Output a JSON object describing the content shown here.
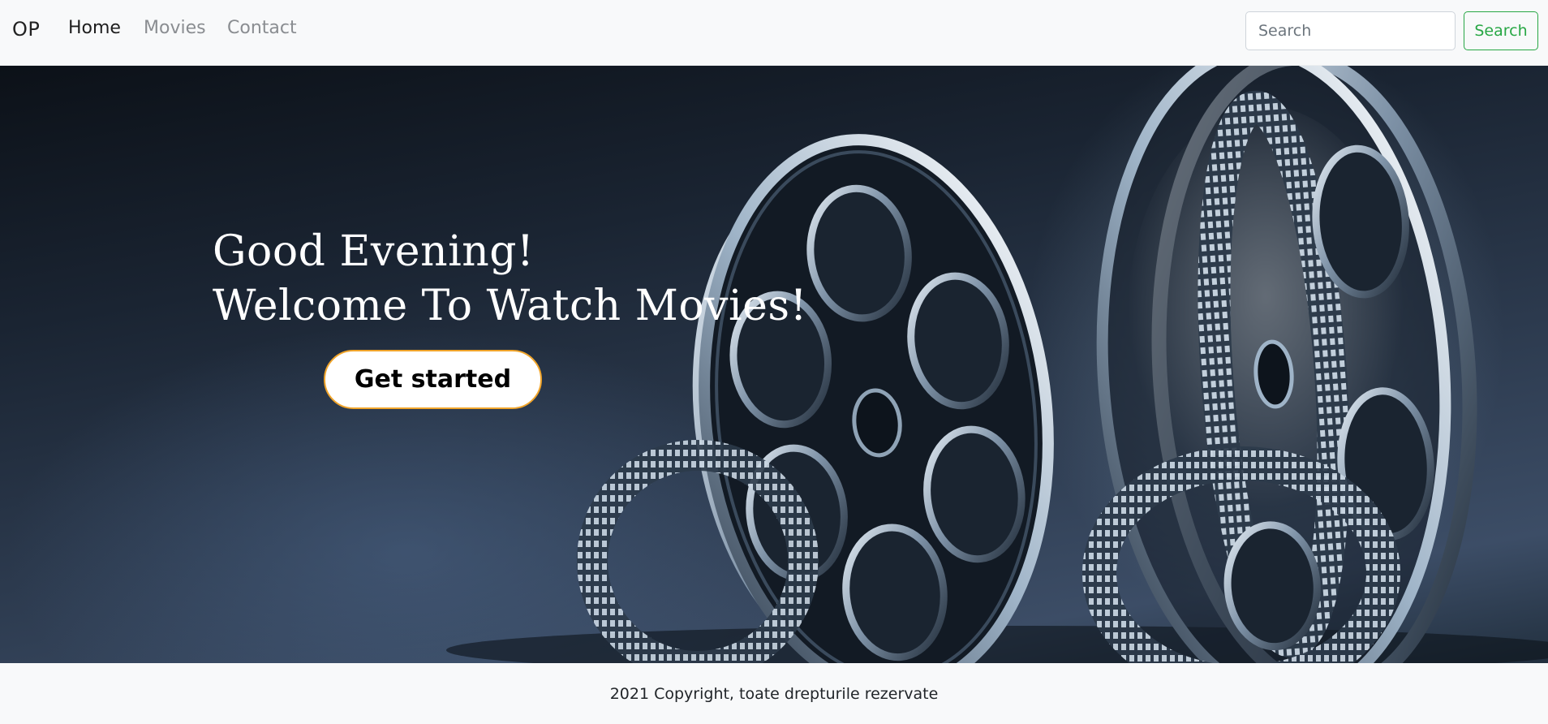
{
  "navbar": {
    "brand": "OP",
    "links": [
      {
        "label": "Home",
        "active": true
      },
      {
        "label": "Movies",
        "active": false
      },
      {
        "label": "Contact",
        "active": false
      }
    ],
    "search": {
      "placeholder": "Search",
      "value": "",
      "button_label": "Search"
    }
  },
  "hero": {
    "greeting": "Good Evening!",
    "welcome": "Welcome To Watch Movies!",
    "cta_label": "Get started",
    "background_image": "film-reels"
  },
  "footer": {
    "text": "2021 Copyright, toate drepturile rezervate"
  },
  "colors": {
    "accent_green": "#28a745",
    "cta_border": "#f0a42a",
    "navbar_bg": "#f8f9fa"
  }
}
